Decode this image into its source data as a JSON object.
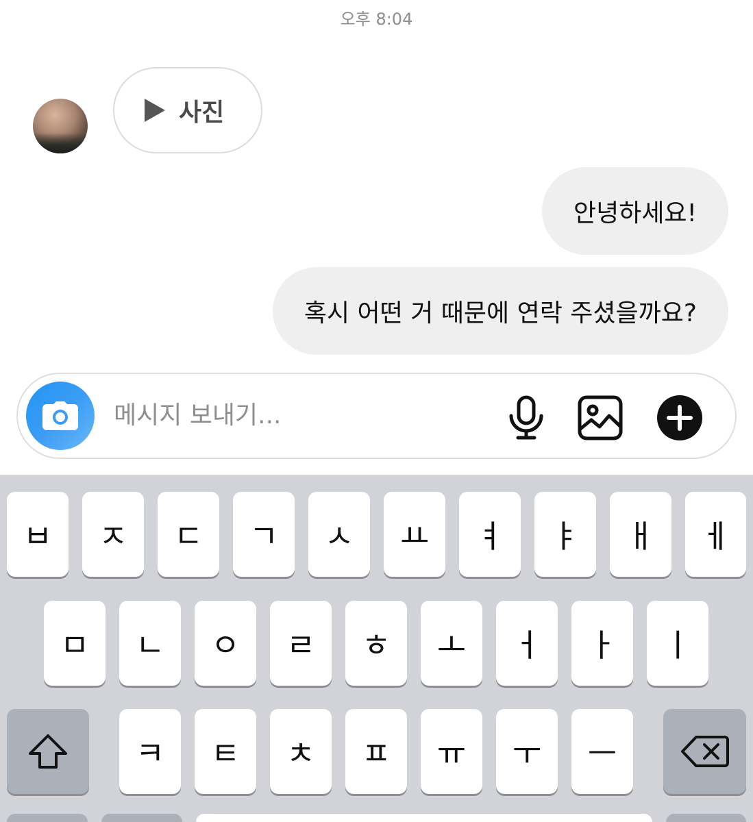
{
  "chat": {
    "timestamp": "오후 8:04",
    "voice_message_label": "사진",
    "messages": [
      "안녕하세요!",
      "혹시 어떤 거 때문에 연락 주셨을까요?"
    ]
  },
  "composer": {
    "placeholder": "메시지 보내기...",
    "value": "",
    "icons": [
      "camera-icon",
      "microphone-icon",
      "gallery-icon",
      "plus-icon"
    ],
    "camera_button_color": "#3b9cf5"
  },
  "keyboard": {
    "row1": [
      "ㅂ",
      "ㅈ",
      "ㄷ",
      "ㄱ",
      "ㅅ",
      "ㅛ",
      "ㅕ",
      "ㅑ",
      "ㅐ",
      "ㅔ"
    ],
    "row2": [
      "ㅁ",
      "ㄴ",
      "ㅇ",
      "ㄹ",
      "ㅎ",
      "ㅗ",
      "ㅓ",
      "ㅏ",
      "ㅣ"
    ],
    "row3": [
      "ㅋ",
      "ㅌ",
      "ㅊ",
      "ㅍ",
      "ㅠ",
      "ㅜ",
      "ㅡ"
    ],
    "shift_icon": "shift-icon",
    "backspace_icon": "backspace-icon"
  }
}
